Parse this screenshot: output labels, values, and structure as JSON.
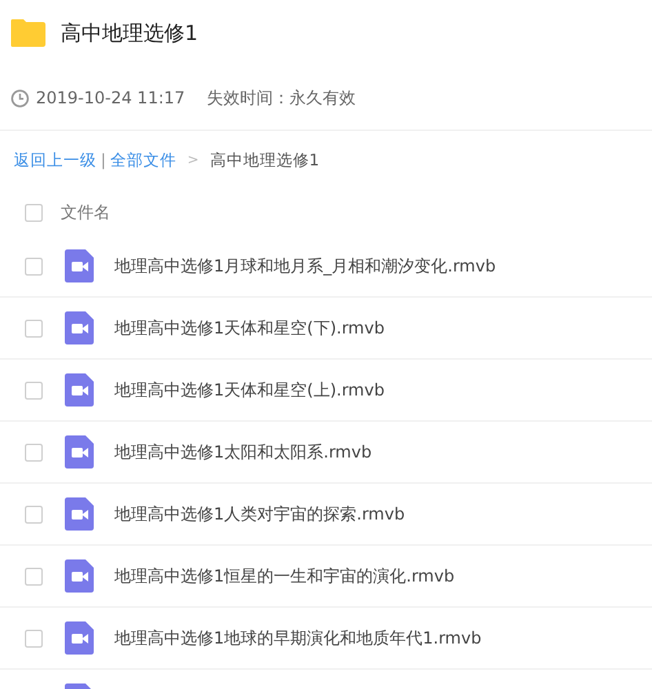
{
  "folder": {
    "title": "高中地理选修1"
  },
  "meta": {
    "time": "2019-10-24 11:17",
    "expiry": "失效时间：永久有效"
  },
  "breadcrumb": {
    "back": "返回上一级",
    "separator": "|",
    "root": "全部文件",
    "arrow": ">",
    "current": "高中地理选修1"
  },
  "header": {
    "checked": false,
    "label": "文件名"
  },
  "files": [
    {
      "kind": "video",
      "checked": false,
      "name": "地理高中选修1月球和地月系_月相和潮汐变化.rmvb"
    },
    {
      "kind": "video",
      "checked": false,
      "name": "地理高中选修1天体和星空(下).rmvb"
    },
    {
      "kind": "video",
      "checked": false,
      "name": "地理高中选修1天体和星空(上).rmvb"
    },
    {
      "kind": "video",
      "checked": false,
      "name": "地理高中选修1太阳和太阳系.rmvb"
    },
    {
      "kind": "video",
      "checked": false,
      "name": "地理高中选修1人类对宇宙的探索.rmvb"
    },
    {
      "kind": "video",
      "checked": false,
      "name": "地理高中选修1恒星的一生和宇宙的演化.rmvb"
    },
    {
      "kind": "video",
      "checked": false,
      "name": "地理高中选修1地球的早期演化和地质年代1.rmvb"
    },
    {
      "kind": "video"
    }
  ]
}
